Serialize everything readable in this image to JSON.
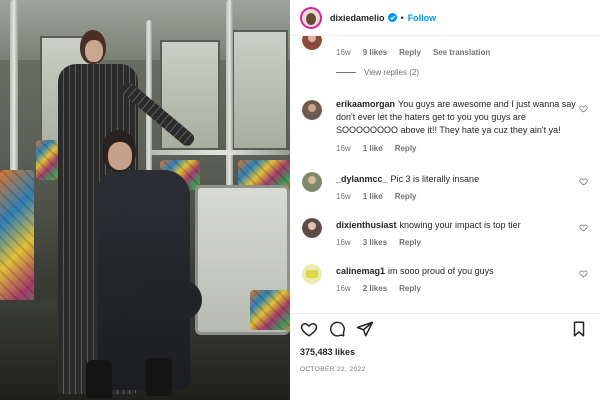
{
  "post": {
    "username": "dixiedamelio",
    "follow_label": "Follow",
    "separator": "•",
    "likes": "375,483 likes",
    "date": "OCTOBER 22, 2022"
  },
  "comments": [
    {
      "username": "",
      "text": "",
      "time": "16w",
      "likes": "9 likes",
      "reply": "Reply",
      "extra": "See translation",
      "avatar_color": "#8a4b3c"
    },
    {
      "username": "erikaamorgan",
      "text": "You guys are awesome and I just wanna say don't ever let the haters get to you you guys are SOOOOOOOO above it!! They hate ya cuz they ain't ya!",
      "time": "16w",
      "likes": "1 like",
      "reply": "Reply",
      "avatar_color": "#6a5a50"
    },
    {
      "username": "_dylanmcc_",
      "text": "Pic 3 is literally insane",
      "time": "16w",
      "likes": "1 like",
      "reply": "Reply",
      "avatar_color": "#7a8a6a"
    },
    {
      "username": "dixienthusiast",
      "text": "knowing your impact is top tier",
      "time": "16w",
      "likes": "3 likes",
      "reply": "Reply",
      "avatar_color": "#5c4a44"
    },
    {
      "username": "calinemag1",
      "text": "im sooo proud of you guys",
      "time": "16w",
      "likes": "2 likes",
      "reply": "Reply",
      "avatar_color": "#d8d64a"
    }
  ],
  "view_replies": "View replies (2)",
  "icons": {
    "verified": "verified-badge-icon",
    "like": "heart-icon",
    "comment": "comment-icon",
    "share": "share-icon",
    "save": "bookmark-icon"
  },
  "colors": {
    "accent": "#0095f6",
    "text": "#262626",
    "muted": "#737373"
  }
}
